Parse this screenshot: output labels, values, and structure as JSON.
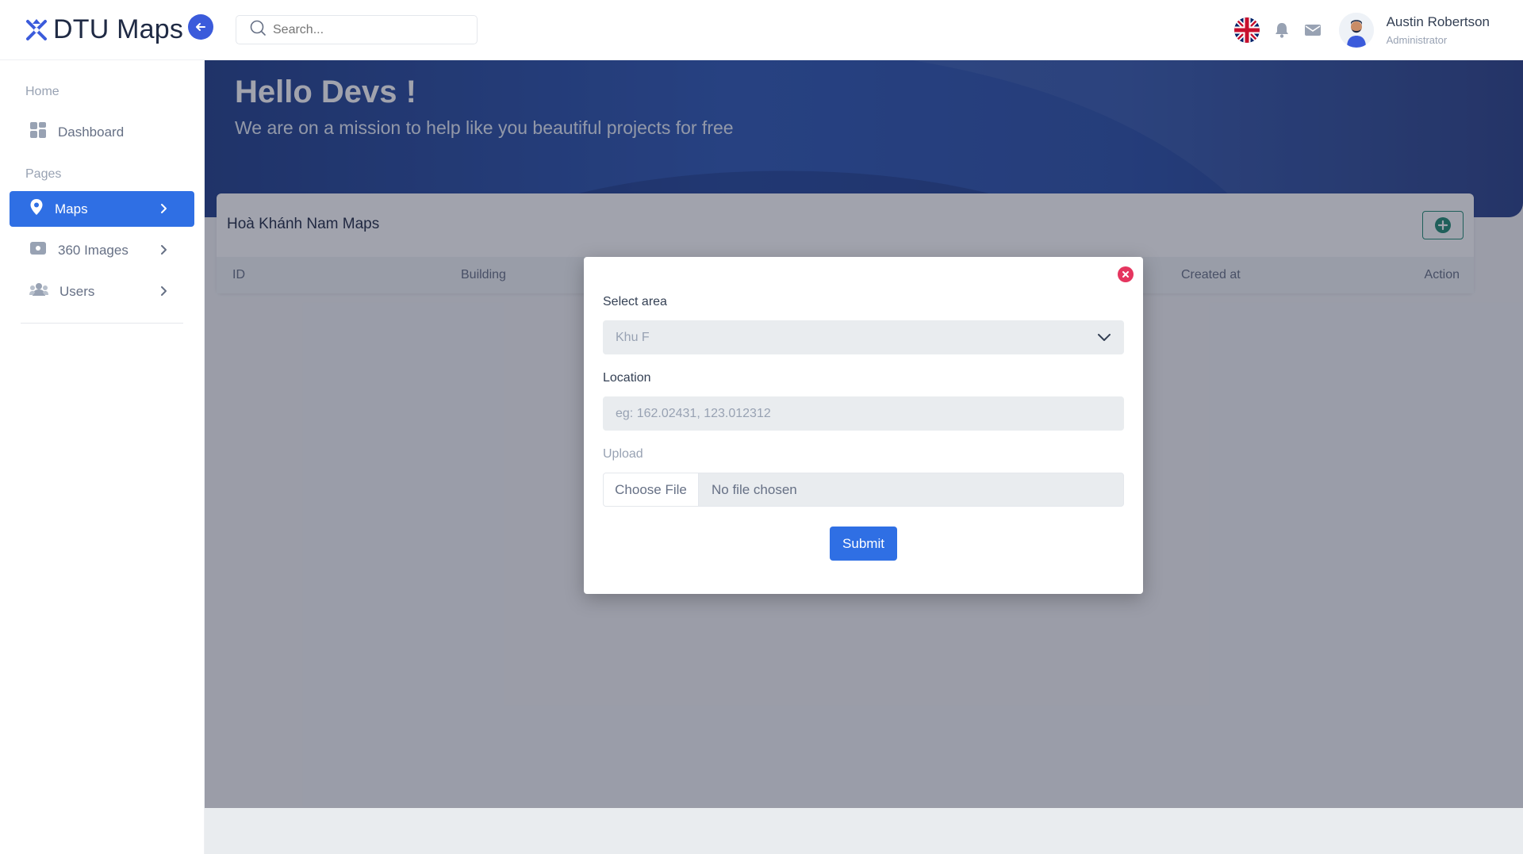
{
  "brand": {
    "name": "DTU Maps",
    "icon": "logo-icon",
    "collapse_icon": "arrow-left-icon"
  },
  "search": {
    "placeholder": "Search..."
  },
  "header": {
    "user_name": "Austin Robertson",
    "user_role": "Administrator",
    "icons": [
      "uk-flag-icon",
      "bell-icon",
      "mail-icon",
      "avatar"
    ]
  },
  "sidebar": {
    "sections": [
      {
        "label": "Home"
      },
      {
        "label": "Pages"
      }
    ],
    "items": [
      {
        "label": "Dashboard",
        "icon": "grid-icon",
        "active": false
      },
      {
        "label": "Maps",
        "icon": "map-pin-icon",
        "active": true
      },
      {
        "label": "360 Images",
        "icon": "panorama-icon",
        "active": false
      },
      {
        "label": "Users",
        "icon": "users-icon",
        "active": false
      }
    ]
  },
  "hero": {
    "title": "Hello Devs !",
    "subtitle": "We are on a mission to help like you beautiful projects for free"
  },
  "card": {
    "title": "Hoà Khánh Nam Maps",
    "columns": [
      "ID",
      "Building",
      "Created at",
      "Action"
    ]
  },
  "modal": {
    "area_label": "Select area",
    "area_value": "Khu F",
    "location_label": "Location",
    "location_placeholder": "eg: 162.02431, 123.012312",
    "upload_label": "Upload",
    "file_button": "Choose File",
    "file_status": "No file chosen",
    "submit": "Submit"
  },
  "colors": {
    "primary": "#2f6fe4",
    "brand": "#3b5bdb",
    "close": "#e5355f",
    "add_button": "#1f8a70"
  }
}
